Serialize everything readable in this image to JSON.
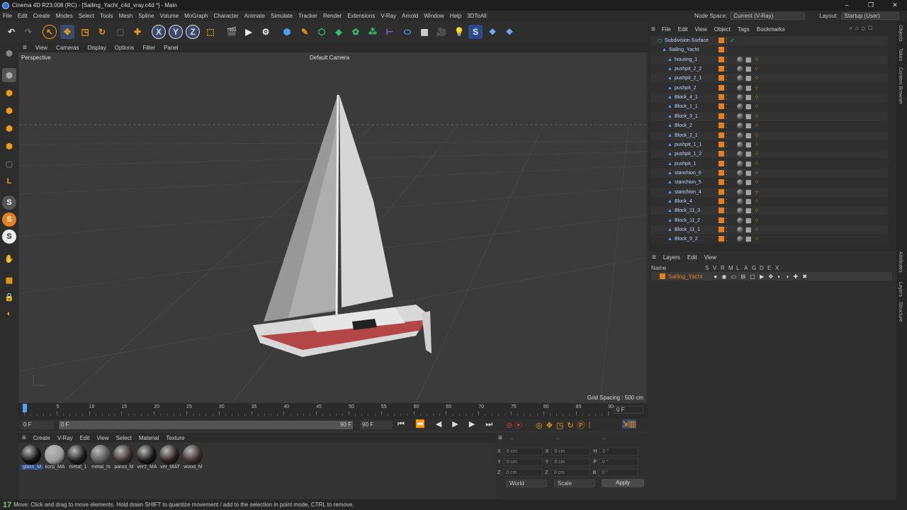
{
  "window": {
    "title": "Cinema 4D R23.008 (RC) - [Sailing_Yacht_c4d_vray.c4d *] - Main",
    "controls": [
      "–",
      "❐",
      "✕"
    ]
  },
  "menu": [
    "File",
    "Edit",
    "Create",
    "Modes",
    "Select",
    "Tools",
    "Mesh",
    "Spline",
    "Volume",
    "MoGraph",
    "Character",
    "Animate",
    "Simulate",
    "Tracker",
    "Render",
    "Extensions",
    "V-Ray",
    "Arnold",
    "Window",
    "Help",
    "3DToAll"
  ],
  "nodespace": {
    "label": "Node Space:",
    "value": "Current (V-Ray)",
    "layout_label": "Layout:",
    "layout_value": "Startup (User)"
  },
  "viewport": {
    "menu": [
      "View",
      "Cameras",
      "Display",
      "Options",
      "Filter",
      "Panel"
    ],
    "view_name": "Perspective",
    "camera": "Default Camera",
    "grid_spacing": "Grid Spacing : 500 cm"
  },
  "timeline": {
    "ticks": [
      "0",
      "5",
      "10",
      "15",
      "20",
      "25",
      "30",
      "35",
      "40",
      "45",
      "50",
      "55",
      "60",
      "65",
      "70",
      "75",
      "80",
      "85",
      "90"
    ],
    "current_frame": "0 F",
    "start": "0 F",
    "range_start": "0 F",
    "range_end": "90 F",
    "end": "90 F"
  },
  "materials": {
    "menu": [
      "Create",
      "V-Ray",
      "Edit",
      "View",
      "Select",
      "Material",
      "Texture"
    ],
    "items": [
      {
        "name": "glass_M",
        "color": "#111"
      },
      {
        "name": "korp_MA",
        "color": "#9a9a9a"
      },
      {
        "name": "metal_1",
        "color": "#1a1a1a"
      },
      {
        "name": "metal_hi",
        "color": "#555"
      },
      {
        "name": "parus_M",
        "color": "#3a2a2a"
      },
      {
        "name": "ver2_MA",
        "color": "#151515"
      },
      {
        "name": "ver_MAT",
        "color": "#2a1f1f"
      },
      {
        "name": "wood_M",
        "color": "#3a2a2a"
      }
    ]
  },
  "coords": {
    "rows": [
      {
        "a": "X",
        "av": "0 cm",
        "b": "X",
        "bv": "0 cm",
        "c": "H",
        "cv": "0 °"
      },
      {
        "a": "Y",
        "av": "0 cm",
        "b": "Y",
        "bv": "0 cm",
        "c": "P",
        "cv": "0 °"
      },
      {
        "a": "Z",
        "av": "0 cm",
        "b": "Z",
        "bv": "0 cm",
        "c": "B",
        "cv": "0 °"
      }
    ],
    "mode": "World",
    "scale": "Scale",
    "apply": "Apply",
    "headers": [
      "--",
      "--",
      "--"
    ]
  },
  "objects": {
    "menu": [
      "File",
      "Edit",
      "View",
      "Object",
      "Tags",
      "Bookmarks"
    ],
    "items": [
      "Subdivision Surface",
      "Sailing_Yacht",
      "housing_1",
      "pushpit_2_2",
      "pushpit_2_1",
      "pushpit_2",
      "Block_4_1",
      "Block_1_1",
      "Block_3_1",
      "Block_2",
      "Block_2_1",
      "pushpit_1_1",
      "pushpit_1_2",
      "pushpit_1",
      "stanchion_6",
      "stanchion_5",
      "stanchion_4",
      "Block_4",
      "Block_11_3",
      "Block_11_2",
      "Block_11_1",
      "Block_9_2"
    ]
  },
  "layers": {
    "menu": [
      "Layers",
      "Edit",
      "View"
    ],
    "columns": "Name",
    "flags": [
      "S",
      "V",
      "R",
      "M",
      "L",
      "A",
      "G",
      "D",
      "E",
      "X"
    ],
    "items": [
      "Sailing_Yacht"
    ]
  },
  "sidetabs": [
    "Objects",
    "Takes",
    "Content Browser",
    "Attributes",
    "Layers",
    "Structure"
  ],
  "status": "Move: Click and drag to move elements. Hold down SHIFT to quantize movement / add to the selection in point mode, CTRL to remove."
}
